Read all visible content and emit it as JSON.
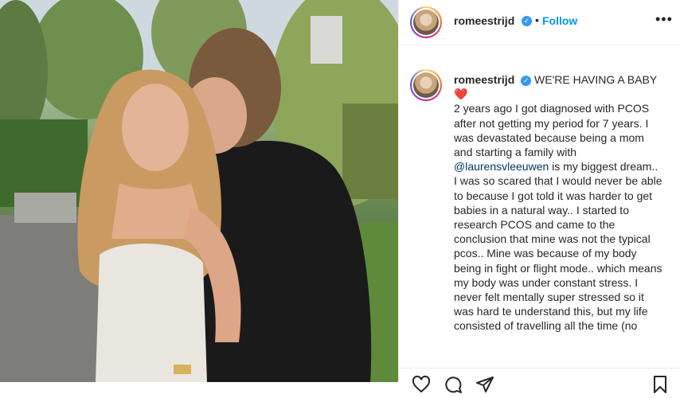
{
  "post": {
    "username": "romeestrijd",
    "verified_mark": "✓",
    "separator": "•",
    "follow_label": "Follow",
    "more_label": "•••"
  },
  "caption": {
    "username": "romeestrijd",
    "verified_mark": "✓",
    "headline": "WE'RE HAVING A BABY",
    "emoji": "❤️",
    "text_before_mention": "2 years ago I got diagnosed with PCOS after not getting my period for 7 years. I was devastated because being a mom and starting a family with ",
    "mention": "@laurensvleeuwen",
    "text_after_mention": " is my biggest dream.. I was so scared that I would never be able to because I got told it was harder to get babies in a natural way.. I started to research PCOS and came to the conclusion that mine was not the typical pcos.. Mine was because of my body being in fight or flight mode.. which means my body was under constant stress. I never felt mentally super stressed so it was hard te understand this, but my life consisted of travelling all the time (no"
  },
  "actions": {
    "icons": [
      "heart-icon",
      "comment-icon",
      "share-icon",
      "bookmark-icon"
    ]
  }
}
